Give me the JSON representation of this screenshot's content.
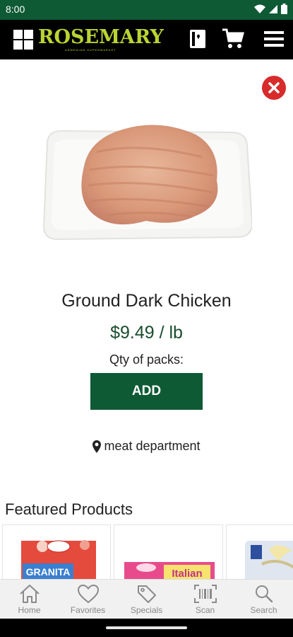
{
  "status_bar": {
    "time": "8:00"
  },
  "header": {
    "brand": "ROSEMARY",
    "brand_sub": "ARMENIAN SUPERMARKET"
  },
  "product": {
    "title": "Ground Dark Chicken",
    "price": "$9.49 / lb",
    "qty_label": "Qty of packs:",
    "add_label": "ADD",
    "location": "meat department"
  },
  "featured": {
    "title": "Featured Products",
    "items": [
      {
        "brand": "",
        "name": "GRANITA"
      },
      {
        "brand": "",
        "name": "Italian"
      },
      {
        "brand": "",
        "name": ""
      }
    ]
  },
  "bottom_nav": {
    "items": [
      {
        "label": "Home",
        "icon": "home-icon"
      },
      {
        "label": "Favorites",
        "icon": "heart-icon"
      },
      {
        "label": "Specials",
        "icon": "tag-icon"
      },
      {
        "label": "Scan",
        "icon": "barcode-icon"
      },
      {
        "label": "Search",
        "icon": "search-icon"
      }
    ]
  },
  "colors": {
    "primary": "#0e5a34",
    "brand": "#b9d432",
    "close": "#d82b2b"
  }
}
